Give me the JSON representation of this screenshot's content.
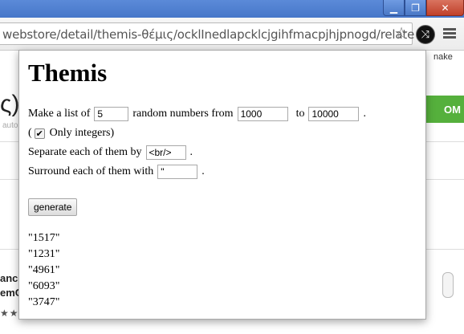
{
  "browser": {
    "url_prefix": "webstore/detail/themis-θέμις/ocklInedlapcklcjgihfmacpjhjpnogd/relate",
    "window_controls": {
      "minimize_icon": "minimize-icon",
      "maximize_icon": "maximize-icon",
      "close_icon": "close-icon"
    }
  },
  "background_page": {
    "title_fragment": "ς)",
    "subtitle_fragment": "auto",
    "button_fragment": "OM",
    "snake_text": "nake",
    "card_line1": "ance",
    "card_line2": "emC",
    "stars": "★★"
  },
  "popup": {
    "title": "Themis",
    "list_prefix": "Make a list of",
    "count_value": "5",
    "random_from": "random numbers from",
    "from_value": "1000",
    "to_label": "to",
    "to_value": "10000",
    "period": ".",
    "paren_open": "(",
    "integers_label": "Only integers)",
    "integers_checked": true,
    "separate_label": "Separate each of them by",
    "separator_value": "<br/>",
    "surround_label": "Surround each of them with",
    "surround_value": "\"",
    "generate_label": "generate",
    "results": [
      "\"1517\"",
      "\"1231\"",
      "\"4961\"",
      "\"6093\"",
      "\"3747\""
    ]
  }
}
